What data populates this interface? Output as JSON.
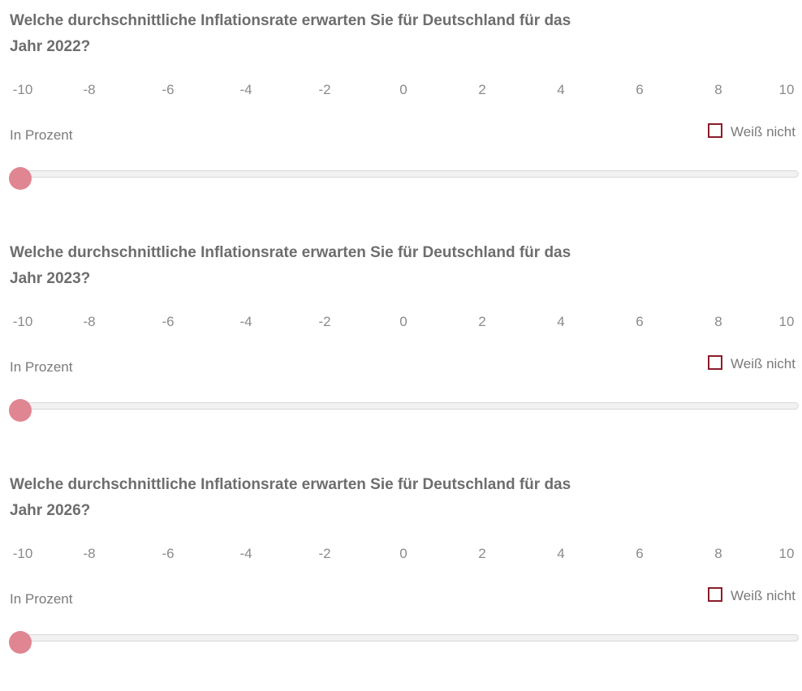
{
  "colors": {
    "thumb": "#e08592",
    "checkbox_border": "#8a1c2b",
    "track": "#f1f1f1"
  },
  "scale_ticks": [
    "-10",
    "-8",
    "-6",
    "-4",
    "-2",
    "0",
    "2",
    "4",
    "6",
    "8",
    "10"
  ],
  "questions": [
    {
      "line1": "Welche durchschnittliche Inflationsrate erwarten Sie für Deutschland für das",
      "line2": "Jahr 2022?",
      "unit_label": "In Prozent",
      "dont_know_label": "Weiß nicht",
      "dont_know_checked": false,
      "slider_value": -10
    },
    {
      "line1": "Welche durchschnittliche Inflationsrate erwarten Sie für Deutschland für das",
      "line2": "Jahr 2023?",
      "unit_label": "In Prozent",
      "dont_know_label": "Weiß nicht",
      "dont_know_checked": false,
      "slider_value": -10
    },
    {
      "line1": "Welche durchschnittliche Inflationsrate erwarten Sie für Deutschland für das",
      "line2": "Jahr 2026?",
      "unit_label": "In Prozent",
      "dont_know_label": "Weiß nicht",
      "dont_know_checked": false,
      "slider_value": -10
    }
  ]
}
